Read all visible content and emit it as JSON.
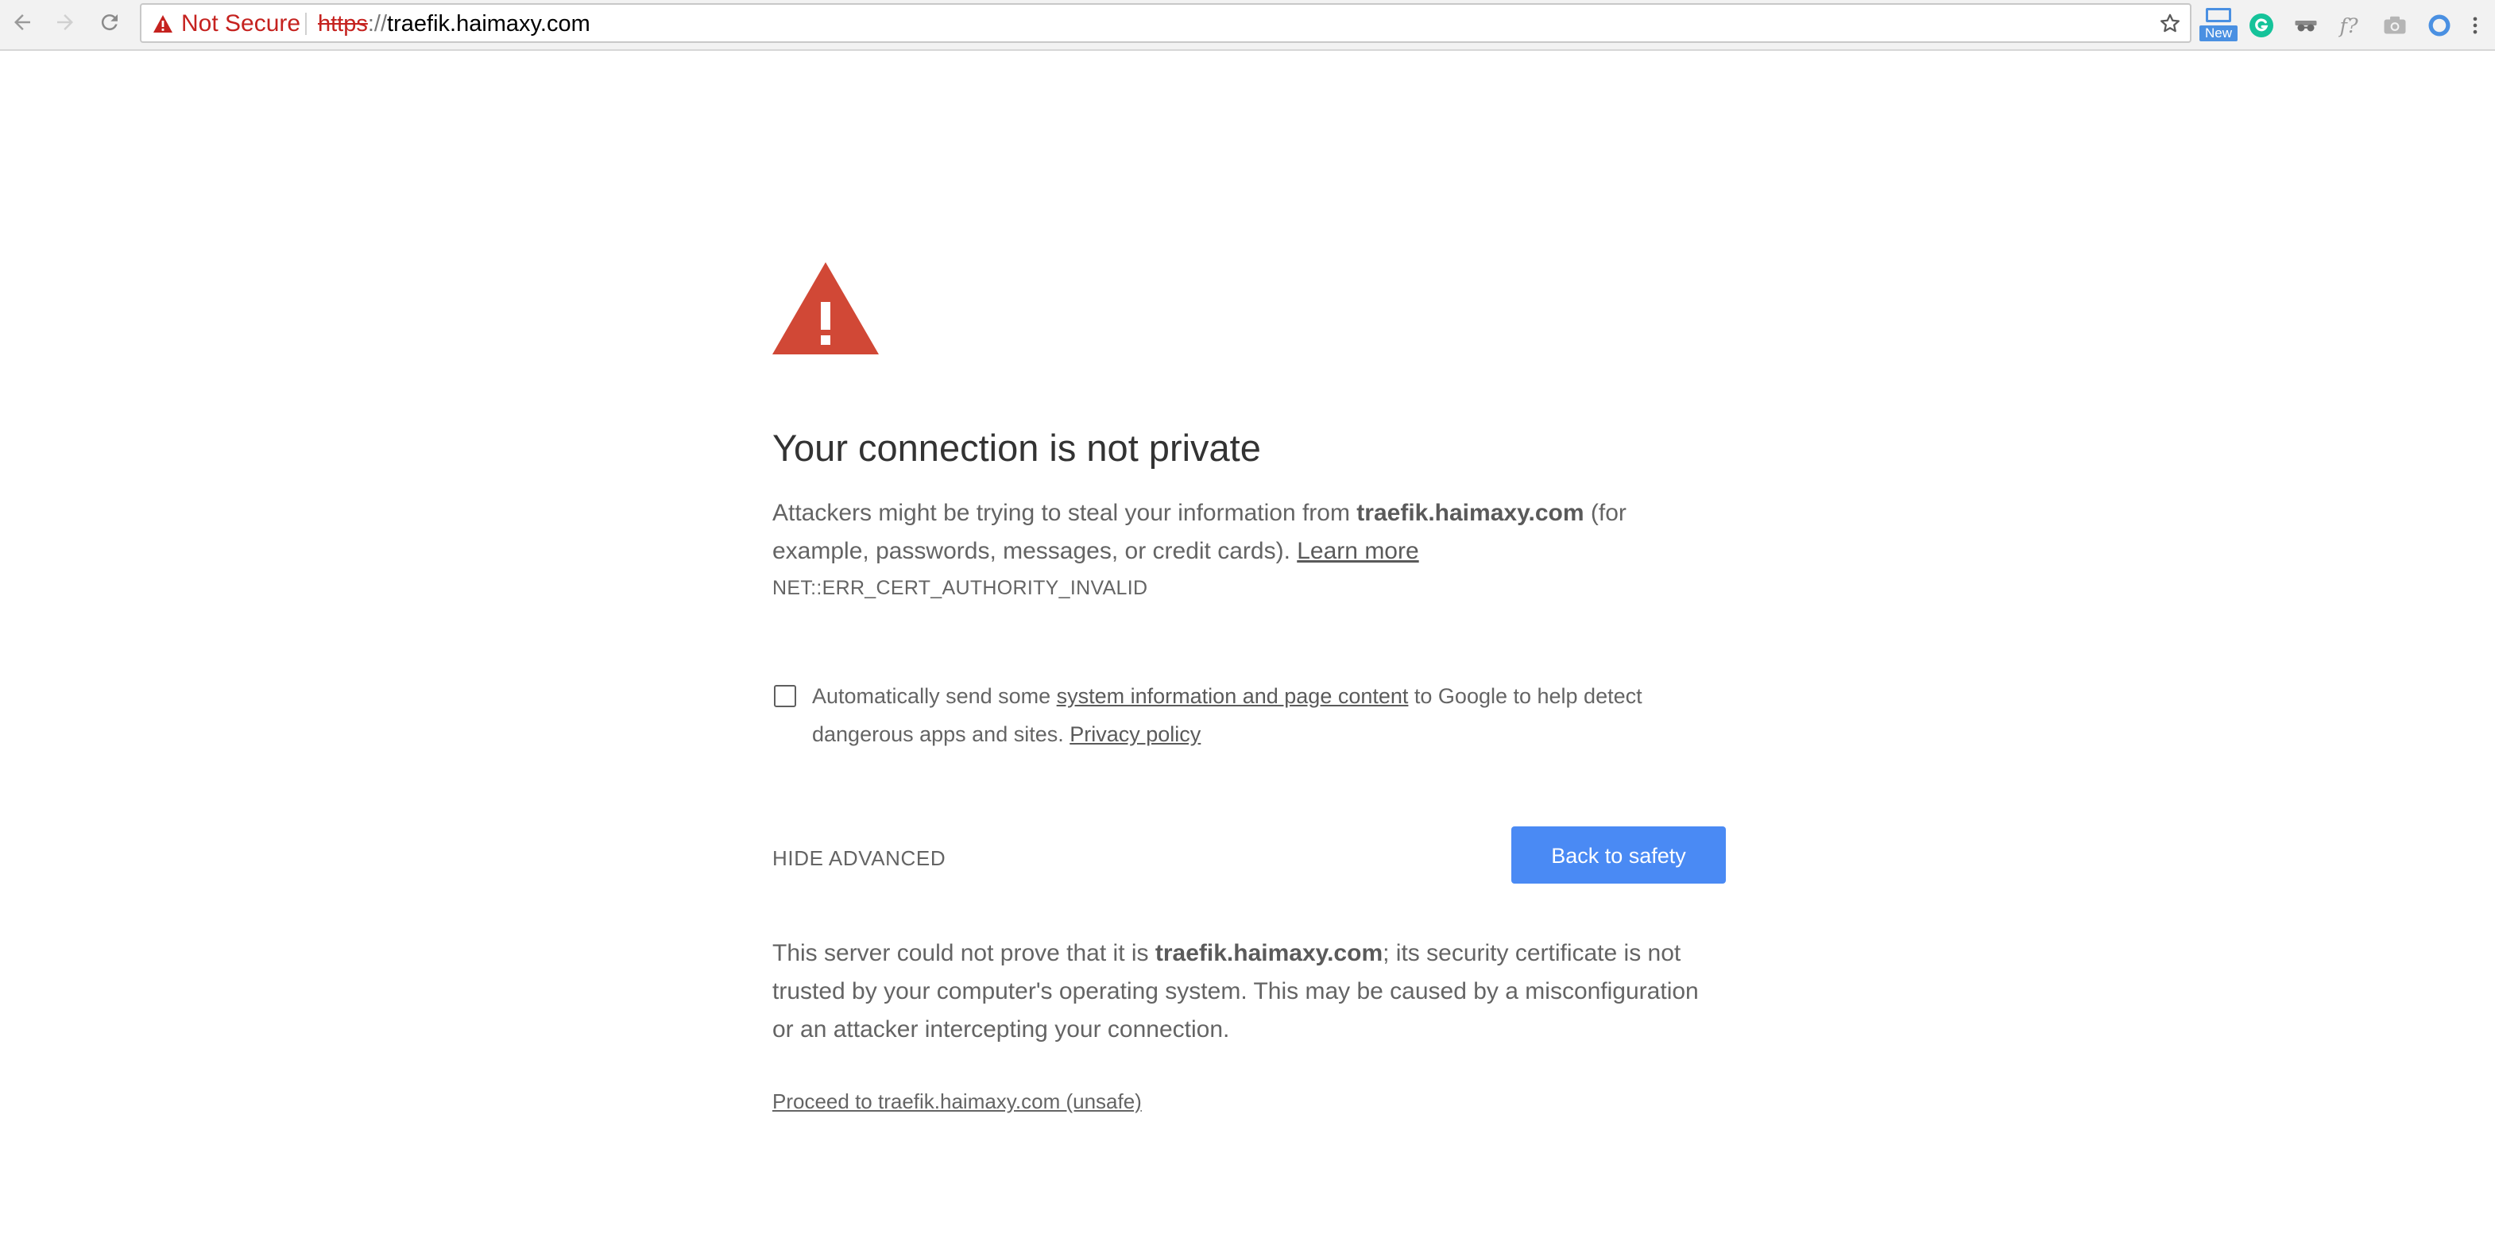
{
  "browser": {
    "security_label": "Not Secure",
    "url_scheme": "https",
    "url_separator": "://",
    "url_host": "traefik.haimaxy.com",
    "extensions": {
      "new_badge_label": "New",
      "icons": [
        "new-extension-icon",
        "grammarly-icon",
        "disguise-mask-icon",
        "formula-icon",
        "camera-icon",
        "circle-extension-icon"
      ]
    },
    "colors": {
      "insecure_red": "#c5221f"
    }
  },
  "interstitial": {
    "heading": "Your connection is not private",
    "intro_before": "Attackers might be trying to steal your information from ",
    "intro_host": "traefik.haimaxy.com",
    "intro_after": " (for example, passwords, messages, or credit cards). ",
    "learn_more": "Learn more",
    "error_code": "NET::ERR_CERT_AUTHORITY_INVALID",
    "optin": {
      "checked": false,
      "before": "Automatically send some ",
      "link": "system information and page content",
      "after": " to Google to help detect dangerous apps and sites. ",
      "privacy_link": "Privacy policy"
    },
    "hide_advanced": "HIDE ADVANCED",
    "back_button": "Back to safety",
    "details_before": "This server could not prove that it is ",
    "details_host": "traefik.haimaxy.com",
    "details_after": "; its security certificate is not trusted by your computer's operating system. This may be caused by a misconfiguration or an attacker intercepting your connection.",
    "proceed_link": "Proceed to traefik.haimaxy.com (unsafe)",
    "colors": {
      "warning_red": "#d14836",
      "button_blue": "#4a8af4"
    }
  }
}
